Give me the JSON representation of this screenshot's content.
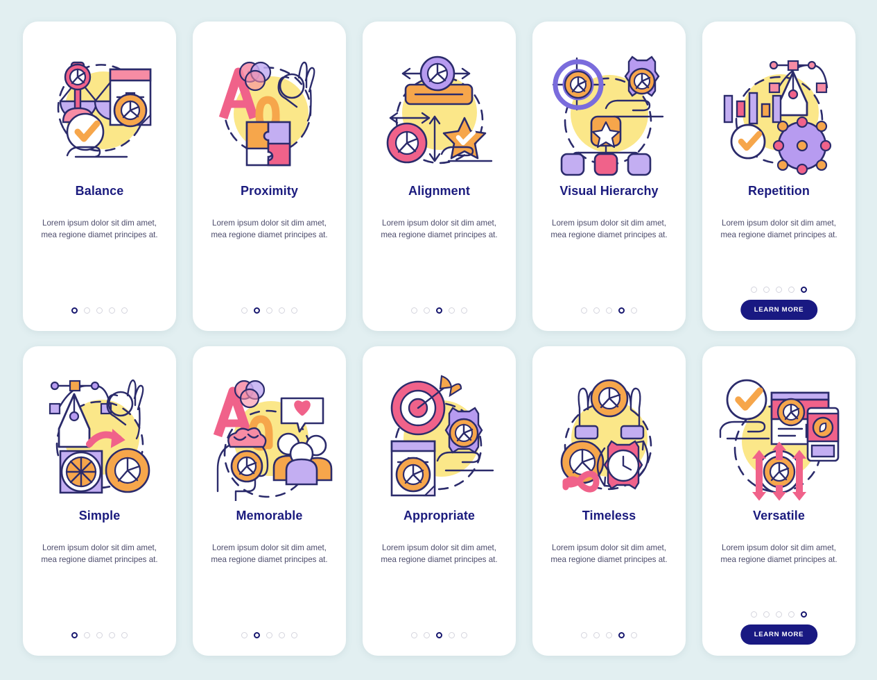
{
  "page": {
    "background_color": "#e2eff1",
    "card_background": "#ffffff",
    "title_color": "#1b1b7e",
    "body_color": "#4c4b6b",
    "accent_navy": "#191982",
    "palette": {
      "pink": "#f0628a",
      "pink_light": "#f78ca4",
      "purple": "#b79bf0",
      "orange": "#f6a64b",
      "orange_light": "#fbc06a",
      "yellow": "#fbe789",
      "outline": "#2b2b6b"
    }
  },
  "common": {
    "description": "Lorem ipsum dolor sit dim amet, mea regione diamet principes at.",
    "cta_label": "LEARN MORE",
    "dot_count": 5
  },
  "cards": [
    {
      "id": "balance",
      "title": "Balance",
      "illustration": "balance-illustration",
      "active_dot": 0,
      "has_cta": false
    },
    {
      "id": "proximity",
      "title": "Proximity",
      "illustration": "proximity-illustration",
      "active_dot": 1,
      "has_cta": false
    },
    {
      "id": "alignment",
      "title": "Alignment",
      "illustration": "alignment-illustration",
      "active_dot": 2,
      "has_cta": false
    },
    {
      "id": "visual-hierarchy",
      "title": "Visual Hierarchy",
      "illustration": "visual-hierarchy-illustration",
      "active_dot": 3,
      "has_cta": false
    },
    {
      "id": "repetition",
      "title": "Repetition",
      "illustration": "repetition-illustration",
      "active_dot": 4,
      "has_cta": true
    },
    {
      "id": "simple",
      "title": "Simple",
      "illustration": "simple-illustration",
      "active_dot": 0,
      "has_cta": false
    },
    {
      "id": "memorable",
      "title": "Memorable",
      "illustration": "memorable-illustration",
      "active_dot": 1,
      "has_cta": false
    },
    {
      "id": "appropriate",
      "title": "Appropriate",
      "illustration": "appropriate-illustration",
      "active_dot": 2,
      "has_cta": false
    },
    {
      "id": "timeless",
      "title": "Timeless",
      "illustration": "timeless-illustration",
      "active_dot": 3,
      "has_cta": false
    },
    {
      "id": "versatile",
      "title": "Versatile",
      "illustration": "versatile-illustration",
      "active_dot": 4,
      "has_cta": true
    }
  ]
}
